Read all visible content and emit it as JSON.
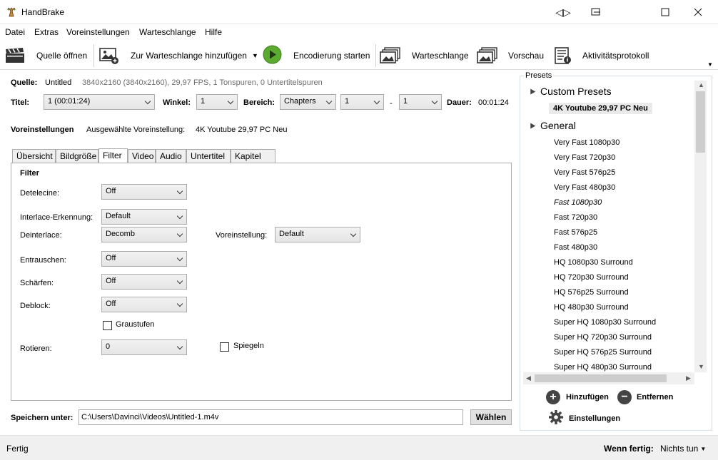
{
  "window": {
    "title": "HandBrake",
    "controls": [
      "◁▷",
      "—",
      "☐",
      "✕"
    ]
  },
  "menu": [
    "Datei",
    "Extras",
    "Voreinstellungen",
    "Warteschlange",
    "Hilfe"
  ],
  "toolbar": {
    "open_source": "Quelle öffnen",
    "add_queue": "Zur Warteschlange hinzufügen",
    "start_encode": "Encodierung starten",
    "queue": "Warteschlange",
    "preview": "Vorschau",
    "activity_log": "Aktivitätsprotokoll"
  },
  "source": {
    "label": "Quelle:",
    "name": "Untitled",
    "info": "3840x2160 (3840x2160), 29,97 FPS, 1 Tonspuren, 0 Untertitelspuren"
  },
  "title_row": {
    "title_label": "Titel:",
    "title_value": "1 (00:01:24)",
    "angle_label": "Winkel:",
    "angle_value": "1",
    "range_label": "Bereich:",
    "range_type": "Chapters",
    "range_start": "1",
    "range_sep": "-",
    "range_end": "1",
    "duration_label": "Dauer:",
    "duration_value": "00:01:24"
  },
  "preset_row": {
    "label": "Voreinstellungen",
    "selected_label": "Ausgewählte Voreinstellung:",
    "selected_value": "4K Youtube 29,97 PC Neu"
  },
  "tabs": [
    "Übersicht",
    "Bildgröße",
    "Filter",
    "Video",
    "Audio",
    "Untertitel",
    "Kapitel"
  ],
  "active_tab": "Filter",
  "filter": {
    "heading": "Filter",
    "detelecine_label": "Detelecine:",
    "detelecine_value": "Off",
    "interlace_label": "Interlace-Erkennung:",
    "interlace_value": "Default",
    "deinterlace_label": "Deinterlace:",
    "deinterlace_value": "Decomb",
    "deint_preset_label": "Voreinstellung:",
    "deint_preset_value": "Default",
    "denoise_label": "Entrauschen:",
    "denoise_value": "Off",
    "sharpen_label": "Schärfen:",
    "sharpen_value": "Off",
    "deblock_label": "Deblock:",
    "deblock_value": "Off",
    "grayscale_label": "Graustufen",
    "rotate_label": "Rotieren:",
    "rotate_value": "0",
    "mirror_label": "Spiegeln"
  },
  "save": {
    "label": "Speichern unter:",
    "path": "C:\\Users\\Davinci\\Videos\\Untitled-1.m4v",
    "browse": "Wählen"
  },
  "presets": {
    "title": "Presets",
    "custom_group": "Custom Presets",
    "custom_items": [
      "4K Youtube 29,97 PC Neu"
    ],
    "general_group": "General",
    "general_items": [
      "Very Fast 1080p30",
      "Very Fast 720p30",
      "Very Fast 576p25",
      "Very Fast 480p30",
      "Fast 1080p30",
      "Fast 720p30",
      "Fast 576p25",
      "Fast 480p30",
      "HQ 1080p30 Surround",
      "HQ 720p30 Surround",
      "HQ 576p25 Surround",
      "HQ 480p30 Surround",
      "Super HQ 1080p30 Surround",
      "Super HQ 720p30 Surround",
      "Super HQ 576p25 Surround",
      "Super HQ 480p30 Surround"
    ],
    "add": "Hinzufügen",
    "remove": "Entfernen",
    "settings": "Einstellungen"
  },
  "status": {
    "left": "Fertig",
    "when_done_label": "Wenn fertig:",
    "when_done_value": "Nichts tun"
  }
}
